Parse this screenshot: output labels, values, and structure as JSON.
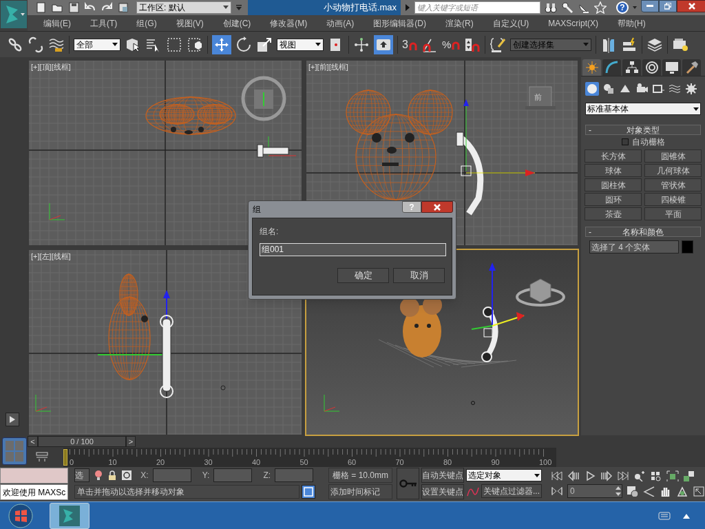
{
  "title_bar": {
    "workspace": "工作区: 默认",
    "title": "小动物打电话.max",
    "search": {
      "placeholder": "键入关键字或短语"
    },
    "help": "?"
  },
  "menu": [
    "编辑(E)",
    "工具(T)",
    "组(G)",
    "视图(V)",
    "创建(C)",
    "修改器(M)",
    "动画(A)",
    "图形编辑器(D)",
    "渲染(R)",
    "自定义(U)",
    "MAXScript(X)",
    "帮助(H)"
  ],
  "toolbar": {
    "selection_filter": "全部",
    "reference_coord": "视图",
    "snap": "3",
    "percent_snap": "%",
    "named_selection": "创建选择集",
    "move_selected": true
  },
  "viewports": [
    {
      "label": "[+][顶][线框]",
      "active": false,
      "kind": "top"
    },
    {
      "label": "[+][前][线框]",
      "active": false,
      "kind": "front",
      "cube": "前"
    },
    {
      "label": "[+][左][线框]",
      "active": false,
      "kind": "left"
    },
    {
      "active": true,
      "kind": "perspective"
    }
  ],
  "command_panel": {
    "tabs": [
      {
        "selected": true
      },
      {
        "selected": false
      },
      {
        "selected": false
      },
      {
        "selected": false
      },
      {
        "selected": false
      },
      {
        "selected": false
      }
    ],
    "categories": [
      {
        "selected": true
      },
      {
        "selected": false
      },
      {
        "selected": false
      },
      {
        "selected": false
      },
      {
        "selected": false
      },
      {
        "selected": false
      },
      {
        "selected": false
      }
    ],
    "dropdown": "标准基本体",
    "object_type": {
      "sign": "-",
      "title": "对象类型",
      "auto_grid": {
        "label": "自动栅格",
        "checked": false
      },
      "buttons": [
        "长方体",
        "圆锥体",
        "球体",
        "几何球体",
        "圆柱体",
        "管状体",
        "圆环",
        "四棱锥",
        "茶壶",
        "平面"
      ]
    },
    "name_and_color": {
      "sign": "-",
      "title": "名称和颜色",
      "value": "选择了 4 个实体",
      "color": "#000000"
    }
  },
  "dialog": {
    "title": "组",
    "help": "?",
    "label": "组名:",
    "value": "组001",
    "buttons": [
      "确定",
      "取消"
    ]
  },
  "time_slider": {
    "prev": "<",
    "reading": "0 / 100",
    "next": ">"
  },
  "trackbar": {
    "ticks": [
      "0",
      "10",
      "20",
      "30",
      "40",
      "50",
      "60",
      "70",
      "80",
      "90",
      "100"
    ]
  },
  "status": {
    "maxscript": "欢迎使用 MAXSc",
    "selection": "选",
    "x": "X:",
    "y": "Y:",
    "z": "Z:",
    "grid": "栅格 = 10.0mm",
    "prompt": "单击并拖动以选择并移动对象",
    "add_time_tag": "添加时间标记",
    "auto_key": "自动关键点",
    "set_key": "设置关键点",
    "key_mode": "选定对象",
    "key_filters": "关键点过滤器...",
    "frame": "0"
  }
}
